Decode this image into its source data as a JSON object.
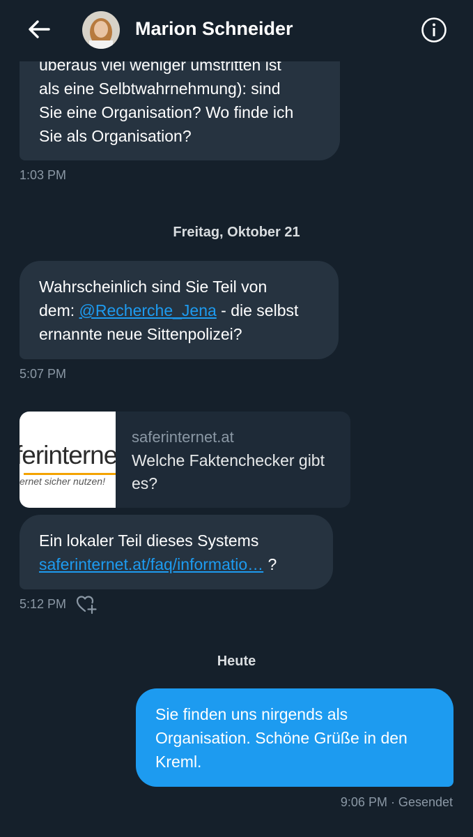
{
  "header": {
    "contact_name": "Marion Schneider"
  },
  "messages": [
    {
      "lines": [
        "überaus viel weniger umstritten ist",
        "als eine Selbtwahrnehmung): sind",
        "Sie eine Organisation? Wo finde ich",
        "Sie als Organisation?"
      ],
      "time": "1:03 PM"
    },
    {
      "day": "Freitag, Oktober 21",
      "line1": "Wahrscheinlich sind Sie Teil von",
      "line2_prefix": "dem: ",
      "mention": "@Recherche_Jena",
      "line2_suffix": " - die selbst",
      "line3": "ernannte neue Sittenpolizei?",
      "time": "5:07 PM"
    },
    {
      "card": {
        "thumb_text": "ferinterne",
        "thumb_sub": "ernet sicher nutzen!",
        "domain": "saferinternet.at",
        "title": "Welche Faktenchecker gibt es?"
      },
      "line1": "Ein lokaler Teil dieses Systems",
      "link": "saferinternet.at/faq/informatio…",
      "link_suffix": " ?",
      "time": "5:12 PM"
    },
    {
      "day": "Heute",
      "lines": [
        "Sie finden uns nirgends als",
        "Organisation. Schöne Grüße in den",
        "Kreml."
      ],
      "time": "9:06 PM · Gesendet"
    }
  ],
  "colors": {
    "background": "#15202b",
    "bubble_in": "#263340",
    "bubble_out": "#1d9bf0",
    "link": "#1d9bf0",
    "muted": "#8b98a5"
  },
  "icons": [
    "back-arrow-icon",
    "info-icon",
    "heart-plus-icon"
  ]
}
